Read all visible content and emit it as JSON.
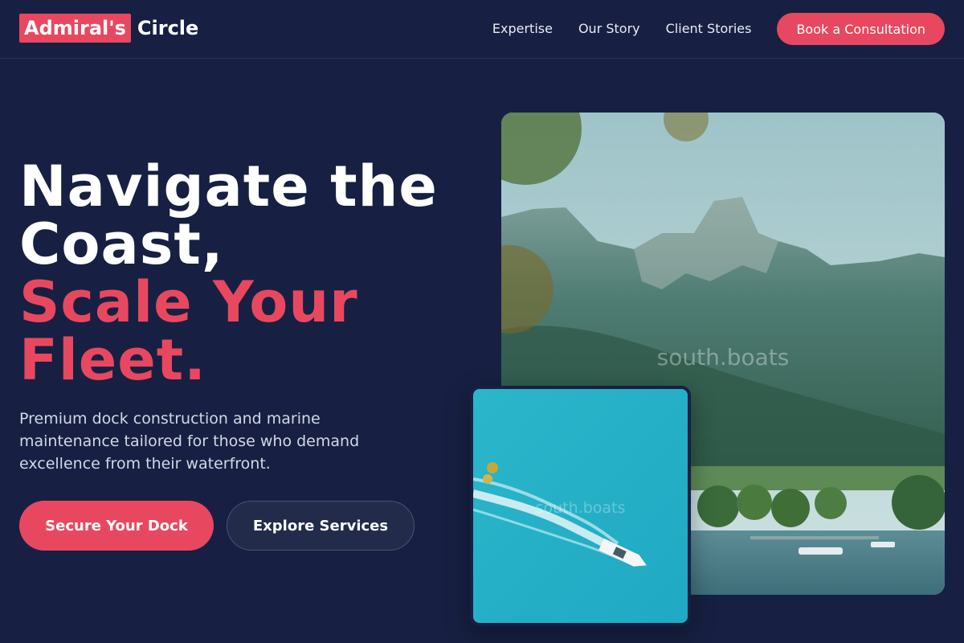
{
  "brand": {
    "highlight": "Admiral's",
    "rest": "Circle"
  },
  "nav": {
    "links": [
      "Expertise",
      "Our Story",
      "Client Stories"
    ],
    "cta": "Book a Consultation"
  },
  "hero": {
    "title_line1": "Navigate the",
    "title_line2": "Coast,",
    "title_accent_line1": "Scale Your",
    "title_accent_line2": "Fleet.",
    "subtitle": "Premium dock construction and marine maintenance tailored for those who demand excellence from their waterfront.",
    "primary_button": "Secure Your Dock",
    "secondary_button": "Explore Services"
  },
  "images": {
    "main_watermark": "south.boats",
    "small_watermark": "south.boats"
  },
  "colors": {
    "background": "#172042",
    "accent": "#e8485f",
    "nav_text": "#e9ecf5"
  }
}
